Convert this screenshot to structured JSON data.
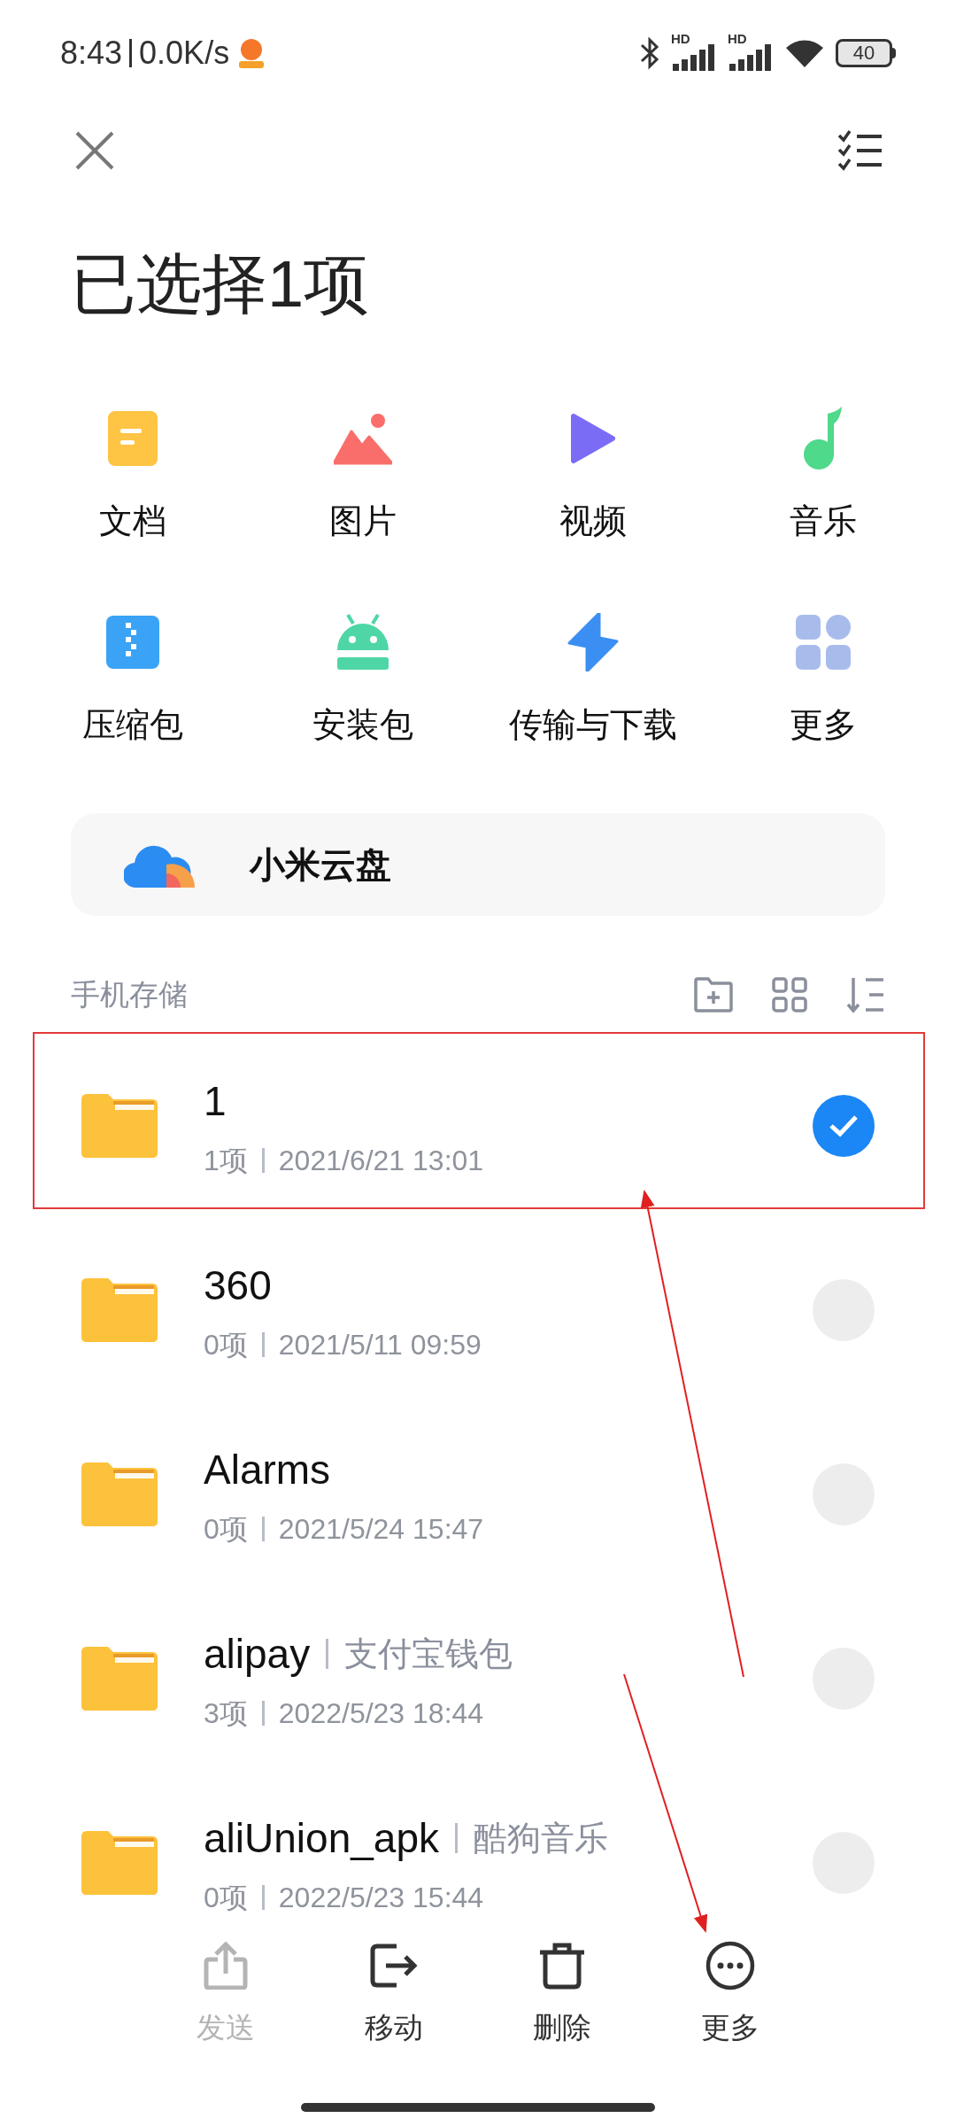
{
  "status_bar": {
    "time": "8:43",
    "speed": "0.0K/s",
    "signals": [
      {
        "label": "HD"
      },
      {
        "label": "HD"
      }
    ],
    "battery": "40"
  },
  "title": "已选择1项",
  "categories": [
    {
      "kind": "document",
      "label": "文档"
    },
    {
      "kind": "image",
      "label": "图片"
    },
    {
      "kind": "video",
      "label": "视频"
    },
    {
      "kind": "music",
      "label": "音乐"
    },
    {
      "kind": "archive",
      "label": "压缩包"
    },
    {
      "kind": "apk",
      "label": "安装包"
    },
    {
      "kind": "transfer",
      "label": "传输与下载"
    },
    {
      "kind": "more",
      "label": "更多"
    }
  ],
  "cloud": {
    "label": "小米云盘"
  },
  "section": {
    "title": "手机存储"
  },
  "files": [
    {
      "name": "1",
      "count": "1项",
      "date": "2021/6/21 13:01",
      "selected": true
    },
    {
      "name": "360",
      "count": "0项",
      "date": "2021/5/11 09:59",
      "selected": false
    },
    {
      "name": "Alarms",
      "count": "0项",
      "date": "2021/5/24 15:47",
      "selected": false
    },
    {
      "name": "alipay",
      "tag": "支付宝钱包",
      "count": "3项",
      "date": "2022/5/23 18:44",
      "selected": false
    },
    {
      "name": "aliUnion_apk",
      "tag": "酷狗音乐",
      "count": "0项",
      "date": "2022/5/23 15:44",
      "selected": false
    }
  ],
  "toolbar": [
    {
      "kind": "share",
      "label": "发送",
      "disabled": true
    },
    {
      "kind": "move",
      "label": "移动",
      "disabled": false
    },
    {
      "kind": "delete",
      "label": "删除",
      "disabled": false
    },
    {
      "kind": "more",
      "label": "更多",
      "disabled": false
    }
  ]
}
